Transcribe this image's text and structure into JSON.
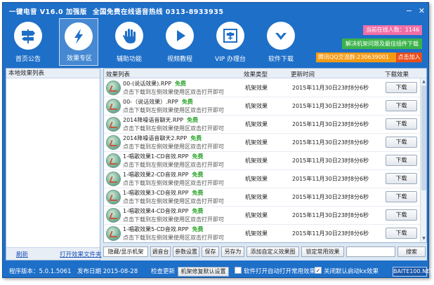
{
  "window": {
    "title": "一键电音 V16.0 加强版",
    "hotline": "全国免费在线语音热线 0313-8933935",
    "controls": {
      "minimize": "−",
      "close": "✕"
    }
  },
  "toolbar": {
    "buttons": [
      {
        "label": "首页公告",
        "icon": "signpost-icon",
        "active": false
      },
      {
        "label": "效果专区",
        "icon": "lightning-icon",
        "active": true
      },
      {
        "label": "辅助功能",
        "icon": "hand-icon",
        "active": false
      },
      {
        "label": "视频教程",
        "icon": "play-icon",
        "active": false
      },
      {
        "label": "VIP 办理台",
        "icon": "flower-icon",
        "active": false
      },
      {
        "label": "软件下载",
        "icon": "download-arrow-icon",
        "active": false
      }
    ]
  },
  "promo": {
    "online_count": "当前在线人数：1146",
    "green_bar": "解决机架问题及最佳插件下载",
    "qq_group": "腾讯QQ交流群:230639001",
    "join": "点击加入"
  },
  "left_panel": {
    "header": "本地效果列表",
    "refresh": "刷新",
    "open_folder": "打开效果文件夹"
  },
  "effects": {
    "columns": {
      "list": "效果列表",
      "type": "效果类型",
      "updated": "更新时间",
      "download": "下载效果"
    },
    "rows": [
      {
        "name": "00-(说话效果).RPP",
        "free": "免费",
        "hint": "点击下载到左侧效果使用区双击打开即可",
        "type": "机架效果",
        "time": "2015年11月30日23时8分6秒",
        "button": "下载"
      },
      {
        "name": "00-（说话效果）.RPP",
        "free": "免费",
        "hint": "点击下载到左侧效果使用区双击打开即可",
        "type": "机架效果",
        "time": "2015年11月30日23时8分6秒",
        "button": "下载"
      },
      {
        "name": "2014降噪语音聊天.RPP",
        "free": "免费",
        "hint": "点击下载到左侧效果使用区双击打开即可",
        "type": "机架效果",
        "time": "2015年11月30日23时8分6秒",
        "button": "下载"
      },
      {
        "name": "2014降噪语音聊天2.RPP",
        "free": "免费",
        "hint": "点击下载到左侧效果使用区双击打开即可",
        "type": "机架效果",
        "time": "2015年11月30日23时8分6秒",
        "button": "下载"
      },
      {
        "name": "1-唱歌效果1-CD音效.RPP",
        "free": "免费",
        "hint": "点击下载到左侧效果使用区双击打开即可",
        "type": "机架效果",
        "time": "2015年11月30日23时8分6秒",
        "button": "下载"
      },
      {
        "name": "1-唱歌效果2-CD音效.RPP",
        "free": "免费",
        "hint": "点击下载到左侧效果使用区双击打开即可",
        "type": "机架效果",
        "time": "2015年11月30日23时8分6秒",
        "button": "下载"
      },
      {
        "name": "1-唱歌效果3-CD音效.RPP",
        "free": "免费",
        "hint": "点击下载到左侧效果使用区双击打开即可",
        "type": "机架效果",
        "time": "2015年11月30日23时8分6秒",
        "button": "下载"
      },
      {
        "name": "1-唱歌效果4-CD音效.RPP",
        "free": "免费",
        "hint": "点击下载到左侧效果使用区双击打开即可",
        "type": "机架效果",
        "time": "2015年11月30日23时8分6秒",
        "button": "下载"
      },
      {
        "name": "1-唱歌效果5-CD音效.RPP",
        "free": "免费",
        "hint": "点击下载到左侧效果使用区双击打开即可",
        "type": "机架效果",
        "time": "2015年11月30日23时8分6秒",
        "button": "下载"
      }
    ]
  },
  "bottom_buttons": {
    "toggle": "隐藏/显示机架",
    "tune": "调音台",
    "params": "参数设置",
    "save": "保存",
    "save_as": "另存为",
    "add_effect": "添加自定义效果图",
    "lock": "锁定常用效果",
    "search_value": "",
    "search": "搜索"
  },
  "statusbar": {
    "version": "程序版本：5.0.1.5061",
    "release_date": "发布日期 2015-08-28",
    "check_update": "检查更新",
    "reset_button": "机架修复默认设置",
    "auto_open": "软件打开自动打开常用效果",
    "auto_open_checked": "",
    "close_kx": "关闭默认启动kx效果",
    "close_kx_checked": "✓",
    "brand": "BAITE100.NET"
  },
  "colors": {
    "frame": "#1e6fc8",
    "free": "#2ea52c",
    "online": "#f06ea6",
    "green_bar": "#3bb34a",
    "qq_bar": "#f39a14",
    "join": "#e84e1c"
  }
}
